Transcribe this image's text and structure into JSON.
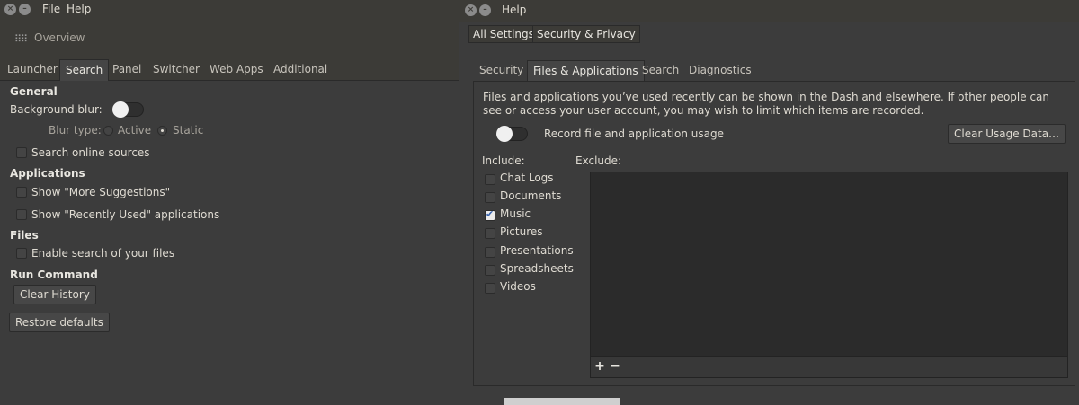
{
  "left": {
    "menus": [
      "File",
      "Help"
    ],
    "overview_label": "Overview",
    "tabs": [
      "Launcher",
      "Search",
      "Panel",
      "Switcher",
      "Web Apps",
      "Additional"
    ],
    "active_tab": "Search",
    "general": {
      "title": "General",
      "background_blur_label": "Background blur:",
      "blur_type_label": "Blur type:",
      "blur_active": "Active",
      "blur_static": "Static",
      "search_online": "Search online sources"
    },
    "applications": {
      "title": "Applications",
      "more_suggestions": "Show \"More Suggestions\"",
      "recently_used": "Show \"Recently Used\" applications"
    },
    "files": {
      "title": "Files",
      "enable_search": "Enable search of your files"
    },
    "run_command": {
      "title": "Run Command",
      "clear_history": "Clear History"
    },
    "restore_defaults": "Restore defaults"
  },
  "right": {
    "title": "Help",
    "breadcrumb": [
      "All Settings",
      "Security & Privacy"
    ],
    "tabs": [
      "Security",
      "Files & Applications",
      "Search",
      "Diagnostics"
    ],
    "active_tab": "Files & Applications",
    "description": "Files and applications you’ve used recently can be shown in the Dash and elsewhere. If other people can see or access your user account, you may wish to limit which items are recorded.",
    "record_label": "Record file and application usage",
    "clear_usage": "Clear Usage Data…",
    "include_label": "Include:",
    "exclude_label": "Exclude:",
    "include_items": [
      {
        "label": "Chat Logs",
        "checked": false
      },
      {
        "label": "Documents",
        "checked": false
      },
      {
        "label": "Music",
        "checked": true
      },
      {
        "label": "Pictures",
        "checked": false
      },
      {
        "label": "Presentations",
        "checked": false
      },
      {
        "label": "Spreadsheets",
        "checked": false
      },
      {
        "label": "Videos",
        "checked": false
      }
    ],
    "add_symbol": "+",
    "remove_symbol": "−"
  }
}
